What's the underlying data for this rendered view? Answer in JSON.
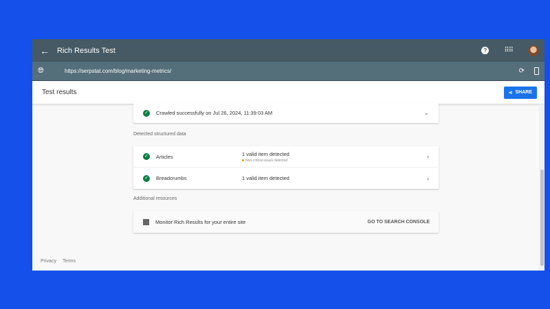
{
  "header": {
    "title": "Rich Results Test",
    "back_icon": "arrow-left",
    "help_icon": "question",
    "apps_icon": "grid"
  },
  "urlbar": {
    "url": "https://serpstat.com/blog/marketing-metrics/"
  },
  "toolbar": {
    "title": "Test results",
    "share_label": "SHARE"
  },
  "crawl": {
    "text": "Crawled successfully on Jul 26, 2024, 11:39:03 AM"
  },
  "structured": {
    "label": "Detected structured data",
    "items": [
      {
        "name": "Articles",
        "status": "1 valid item detected",
        "note": "Non-critical issues detected"
      },
      {
        "name": "Breadcrumbs",
        "status": "1 valid item detected"
      }
    ]
  },
  "resources": {
    "label": "Additional resources",
    "text": "Monitor Rich Results for your entire site",
    "action": "GO TO SEARCH CONSOLE"
  },
  "footer": {
    "privacy": "Privacy",
    "terms": "Terms"
  },
  "colors": {
    "header": "#455a64",
    "urlbar": "#546e7a",
    "accent": "#1a73e8",
    "success": "#0b8043",
    "warning": "#f29900",
    "background": "#1550ea"
  }
}
